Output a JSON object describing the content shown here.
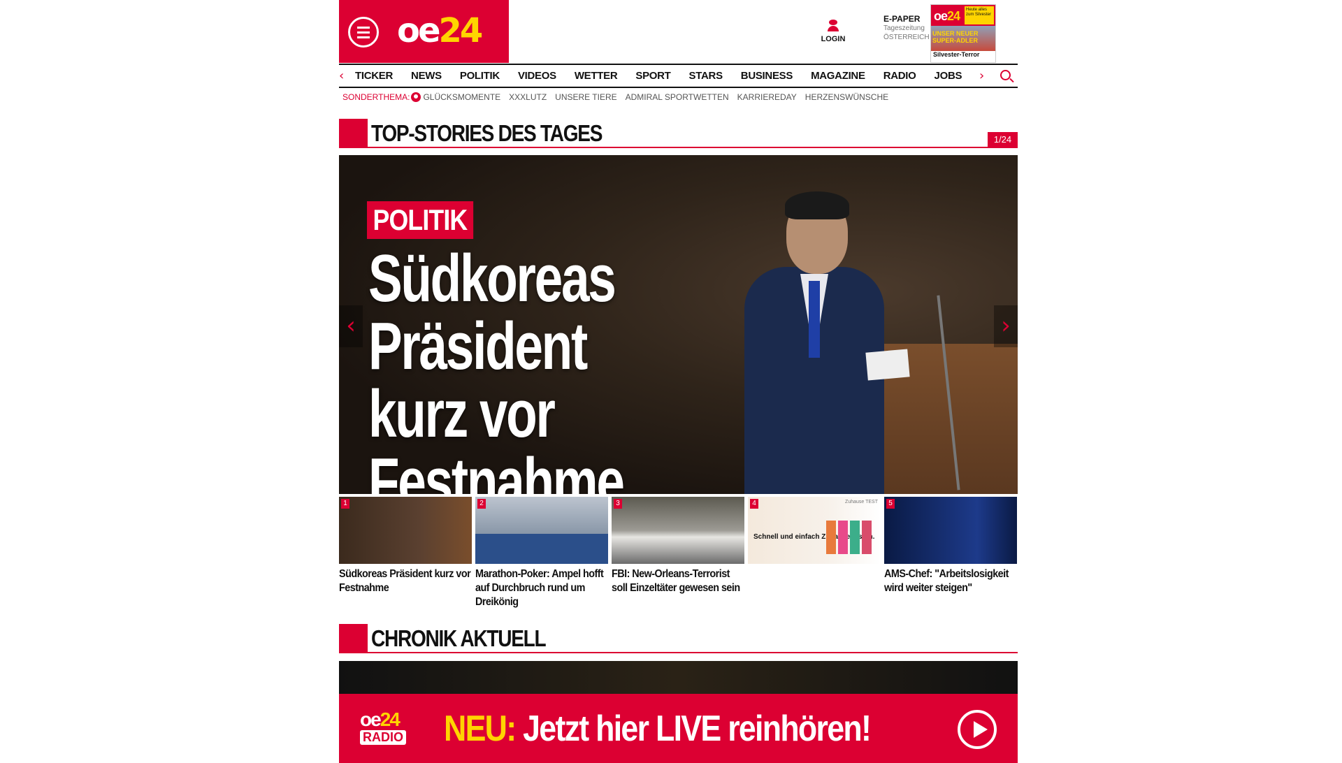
{
  "header": {
    "logo": {
      "part1": "oe",
      "part2": "24"
    },
    "login_label": "LOGIN",
    "epaper": {
      "title": "E-PAPER",
      "line1": "Tageszeitung",
      "line2": "ÖSTERREICH"
    },
    "epaper_cover": {
      "side_text": "Heute alles zum Silvester",
      "headline": "UNSER NEUER SUPER-ADLER",
      "footer": "Silvester-Terror"
    }
  },
  "nav": {
    "items": [
      "TICKER",
      "NEWS",
      "POLITIK",
      "VIDEOS",
      "WETTER",
      "SPORT",
      "STARS",
      "BUSINESS",
      "MAGAZINE",
      "RADIO",
      "JOBS"
    ],
    "prev_arrow": "‹",
    "next_arrow": "›"
  },
  "subnav": {
    "label": "SONDERTHEMA:",
    "items": [
      "GLÜCKSMOMENTE",
      "XXXLUTZ",
      "UNSERE TIERE",
      "ADMIRAL SPORTWETTEN",
      "KARRIEREDAY",
      "HERZENSWÜNSCHE"
    ]
  },
  "top_stories": {
    "title": "TOP-STORIES DES TAGES",
    "counter": "1/24",
    "hero": {
      "tag": "POLITIK",
      "headline": "Südkoreas Präsident kurz vor Festnahme"
    },
    "thumbs": [
      {
        "num": "1",
        "caption": "Südkoreas Präsident kurz vor Festnahme"
      },
      {
        "num": "2",
        "caption": "Marathon-Poker: Ampel hofft auf Durchbruch rund um Dreikönig"
      },
      {
        "num": "3",
        "caption": "FBI: New-Orleans-Terrorist soll Einzeltäter gewesen sein"
      },
      {
        "num": "4",
        "caption": "",
        "ad_text": "Schnell und einfach Zuhause testen.",
        "ad_brand": "Zuhause TEST"
      },
      {
        "num": "5",
        "caption": "AMS-Chef: \"Arbeitslosigkeit wird weiter steigen\""
      }
    ]
  },
  "chronik": {
    "title": "CHRONIK AKTUELL"
  },
  "radio_banner": {
    "logo_top": {
      "part1": "oe",
      "part2": "24"
    },
    "logo_bottom": "RADIO",
    "neu": "NEU:",
    "text": "Jetzt hier LIVE reinhören!"
  },
  "colors": {
    "brand_red": "#dc0032",
    "accent_yellow": "#ffd400"
  }
}
